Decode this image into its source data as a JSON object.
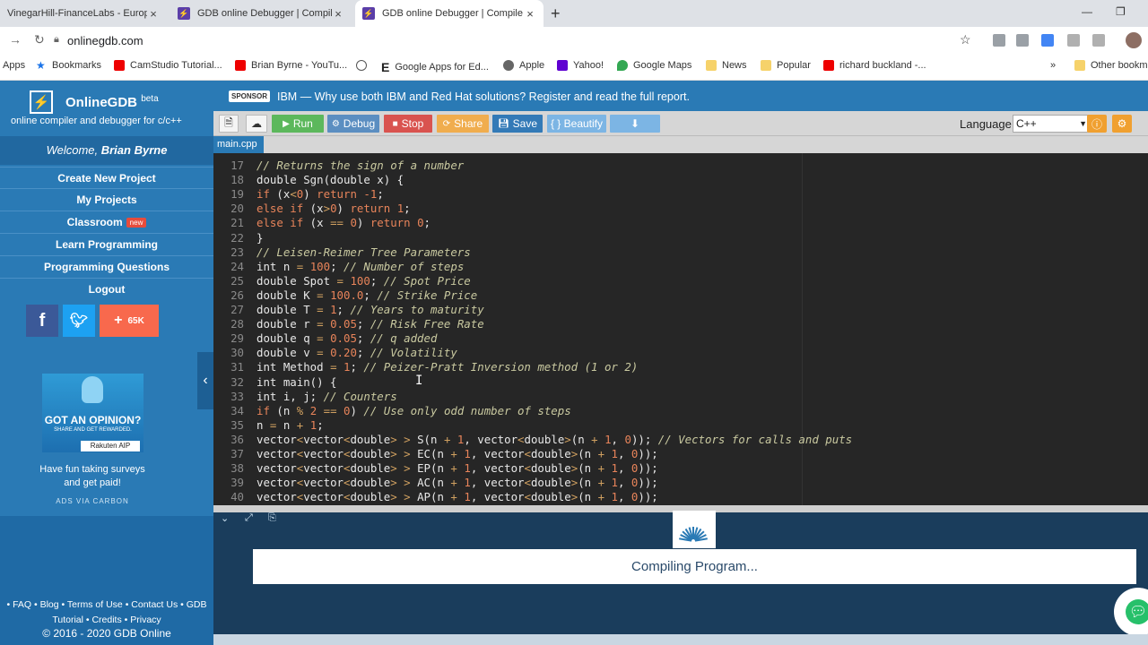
{
  "browser": {
    "tabs": [
      {
        "title": "VinegarHill-FinanceLabs - Europ",
        "favicon_color": "#2e7d32"
      },
      {
        "title": "GDB online Debugger | Compiler",
        "favicon_color": "#5b3ea8"
      },
      {
        "title": "GDB online Debugger | Compile",
        "favicon_color": "#5b3ea8"
      }
    ],
    "url": "onlinegdb.com",
    "bookmarks": [
      {
        "label": "Apps"
      },
      {
        "label": "Bookmarks"
      },
      {
        "label": "CamStudio Tutorial..."
      },
      {
        "label": "Brian Byrne - YouTu..."
      },
      {
        "label": "E"
      },
      {
        "label": "Google Apps for Ed..."
      },
      {
        "label": "Apple"
      },
      {
        "label": "Yahoo!"
      },
      {
        "label": "Google Maps"
      },
      {
        "label": "News"
      },
      {
        "label": "Popular"
      },
      {
        "label": "richard buckland -..."
      },
      {
        "label": "»"
      },
      {
        "label": "Other bookm"
      }
    ]
  },
  "sidebar": {
    "app_name": "OnlineGDB",
    "beta": "beta",
    "tagline": "online compiler and debugger for c/c++",
    "welcome_prefix": "Welcome, ",
    "user": "Brian Byrne",
    "menu": [
      "Create New Project",
      "My Projects",
      "Classroom",
      "Learn Programming",
      "Programming Questions",
      "Logout"
    ],
    "new_badge": "new",
    "social_count": "65K",
    "ad": {
      "headline": "GOT AN OPINION?",
      "subline": "SHARE AND GET REWARDED.",
      "brand": "Rakuten AIP",
      "text_line1": "Have fun taking surveys",
      "text_line2": "and get paid!",
      "via": "ADS VIA CARBON"
    },
    "footer_line1": "• FAQ • Blog • Terms of Use • Contact Us • GDB",
    "footer_line2": "Tutorial • Credits • Privacy",
    "copyright": "© 2016 - 2020 GDB Online"
  },
  "sponsor": {
    "badge": "SPONSOR",
    "text": "IBM — Why use both IBM and Red Hat solutions? Register and read the full report."
  },
  "toolbar": {
    "run": "Run",
    "debug": "Debug",
    "stop": "Stop",
    "share": "Share",
    "save": "Save",
    "beautify": "{ } Beautify",
    "language_label": "Language",
    "language_value": "C++"
  },
  "file_tab": "main.cpp",
  "editor": {
    "lines": [
      {
        "n": "17",
        "html": "<span class=\"cm\">// Returns the sign of a number</span>"
      },
      {
        "n": "18",
        "html": "double Sgn(double x) {"
      },
      {
        "n": "19",
        "html": "<span class=\"kw\">if</span> (x<span class=\"op\">&lt;</span><span class=\"nu\">0</span>) <span class=\"kw\">return</span> <span class=\"nu\">-1</span>;"
      },
      {
        "n": "20",
        "html": "<span class=\"kw\">else if</span> (x<span class=\"op\">&gt;</span><span class=\"nu\">0</span>) <span class=\"kw\">return</span> <span class=\"nu\">1</span>;"
      },
      {
        "n": "21",
        "html": "<span class=\"kw\">else if</span> (x <span class=\"op\">==</span> <span class=\"nu\">0</span>) <span class=\"kw\">return</span> <span class=\"nu\">0</span>;"
      },
      {
        "n": "22",
        "html": "}"
      },
      {
        "n": "23",
        "html": "<span class=\"cm\">// Leisen-Reimer Tree Parameters</span>"
      },
      {
        "n": "24",
        "html": "int n <span class=\"op\">=</span> <span class=\"nu\">100</span>; <span class=\"cm\">// Number of steps</span>"
      },
      {
        "n": "25",
        "html": "double Spot <span class=\"op\">=</span> <span class=\"nu\">100</span>; <span class=\"cm\">// Spot Price</span>"
      },
      {
        "n": "26",
        "html": "double K <span class=\"op\">=</span> <span class=\"nu\">100.0</span>; <span class=\"cm\">// Strike Price</span>"
      },
      {
        "n": "27",
        "html": "double T <span class=\"op\">=</span> <span class=\"nu\">1</span>; <span class=\"cm\">// Years to maturity</span>"
      },
      {
        "n": "28",
        "html": "double r <span class=\"op\">=</span> <span class=\"nu\">0.05</span>; <span class=\"cm\">// Risk Free Rate</span>"
      },
      {
        "n": "29",
        "html": "double q <span class=\"op\">=</span> <span class=\"nu\">0.05</span>; <span class=\"cm\">// q added</span>"
      },
      {
        "n": "30",
        "html": "double v <span class=\"op\">=</span> <span class=\"nu\">0.20</span>; <span class=\"cm\">// Volatility</span>"
      },
      {
        "n": "31",
        "html": "int Method <span class=\"op\">=</span> <span class=\"nu\">1</span>; <span class=\"cm\">// Peizer-Pratt Inversion method (1 or 2)</span>"
      },
      {
        "n": "32",
        "html": "int main() {"
      },
      {
        "n": "33",
        "html": "int i, j; <span class=\"cm\">// Counters</span>"
      },
      {
        "n": "34",
        "html": "<span class=\"kw\">if</span> (n <span class=\"op\">%</span> <span class=\"nu\">2</span> <span class=\"op\">==</span> <span class=\"nu\">0</span>) <span class=\"cm\">// Use only odd number of steps</span>"
      },
      {
        "n": "35",
        "html": "n <span class=\"op\">=</span> n <span class=\"op\">+</span> <span class=\"nu\">1</span>;"
      },
      {
        "n": "36",
        "html": "vector<span class=\"op\">&lt;</span>vector<span class=\"op\">&lt;</span>double<span class=\"op\">&gt;</span> <span class=\"op\">&gt;</span> S(n <span class=\"op\">+</span> <span class=\"nu\">1</span>, vector<span class=\"op\">&lt;</span>double<span class=\"op\">&gt;</span>(n <span class=\"op\">+</span> <span class=\"nu\">1</span>, <span class=\"nu\">0</span>)); <span class=\"cm\">// Vectors for calls and puts</span>"
      },
      {
        "n": "37",
        "html": "vector<span class=\"op\">&lt;</span>vector<span class=\"op\">&lt;</span>double<span class=\"op\">&gt;</span> <span class=\"op\">&gt;</span> EC(n <span class=\"op\">+</span> <span class=\"nu\">1</span>, vector<span class=\"op\">&lt;</span>double<span class=\"op\">&gt;</span>(n <span class=\"op\">+</span> <span class=\"nu\">1</span>, <span class=\"nu\">0</span>));"
      },
      {
        "n": "38",
        "html": "vector<span class=\"op\">&lt;</span>vector<span class=\"op\">&lt;</span>double<span class=\"op\">&gt;</span> <span class=\"op\">&gt;</span> EP(n <span class=\"op\">+</span> <span class=\"nu\">1</span>, vector<span class=\"op\">&lt;</span>double<span class=\"op\">&gt;</span>(n <span class=\"op\">+</span> <span class=\"nu\">1</span>, <span class=\"nu\">0</span>));"
      },
      {
        "n": "39",
        "html": "vector<span class=\"op\">&lt;</span>vector<span class=\"op\">&lt;</span>double<span class=\"op\">&gt;</span> <span class=\"op\">&gt;</span> AC(n <span class=\"op\">+</span> <span class=\"nu\">1</span>, vector<span class=\"op\">&lt;</span>double<span class=\"op\">&gt;</span>(n <span class=\"op\">+</span> <span class=\"nu\">1</span>, <span class=\"nu\">0</span>));"
      },
      {
        "n": "40",
        "html": "vector<span class=\"op\">&lt;</span>vector<span class=\"op\">&lt;</span>double<span class=\"op\">&gt;</span> <span class=\"op\">&gt;</span> AP(n <span class=\"op\">+</span> <span class=\"nu\">1</span>, vector<span class=\"op\">&lt;</span>double<span class=\"op\">&gt;</span>(n <span class=\"op\">+</span> <span class=\"nu\">1</span>, <span class=\"nu\">0</span>));"
      }
    ]
  },
  "console": {
    "status": "Compiling Program..."
  },
  "colors": {
    "brand_blue": "#2a7ab5",
    "run_green": "#5cb85c",
    "stop_red": "#d9534f",
    "share_orange": "#f0ad4e",
    "save_blue": "#337ab7",
    "editor_bg": "#262626"
  }
}
